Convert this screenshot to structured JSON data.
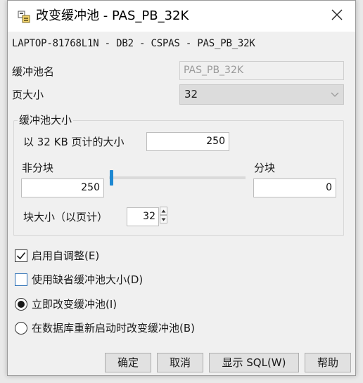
{
  "window": {
    "title": "改变缓冲池 - PAS_PB_32K",
    "close_glyph": "✕"
  },
  "connection": "LAPTOP-81768L1N - DB2 - CSPAS - PAS_PB_32K",
  "form": {
    "bufferpool_name_label": "缓冲池名",
    "bufferpool_name_value": "PAS_PB_32K",
    "page_size_label": "页大小",
    "page_size_value": "32"
  },
  "size_group": {
    "title": "缓冲池大小",
    "pages_label": "以 32 KB 页计的大小",
    "pages_value": "250",
    "nonblock_label": "非分块",
    "nonblock_value": "250",
    "block_label": "分块",
    "block_value": "0",
    "block_size_label": "块大小（以页计）",
    "block_size_value": "32",
    "slider_fraction": 0.0
  },
  "options": {
    "auto_tune_label": "启用自调整(E)",
    "auto_tune_checked": true,
    "use_default_label": "使用缺省缓冲池大小(D)",
    "use_default_checked": false,
    "immediate_label": "立即改变缓冲池(I)",
    "on_restart_label": "在数据库重新启动时改变缓冲池(B)",
    "selected_radio": "immediate"
  },
  "buttons": {
    "ok": "确定",
    "cancel": "取消",
    "show_sql": "显示 SQL(W)",
    "help": "帮助"
  },
  "colors": {
    "accent": "#1e88d2",
    "titlebar": "#ffffff",
    "dialog_bg": "#f0f0f0"
  }
}
